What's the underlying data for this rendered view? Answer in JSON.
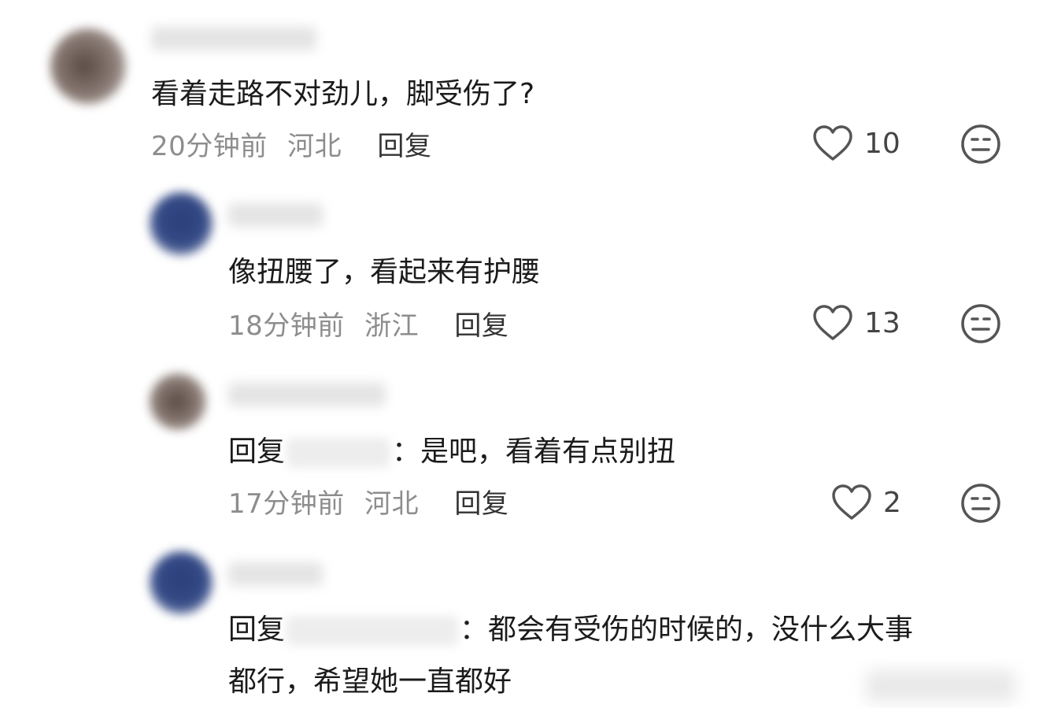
{
  "comments": [
    {
      "text": "看着走路不对劲儿，脚受伤了?",
      "time": "20分钟前",
      "location": "河北",
      "reply_label": "回复",
      "likes": "10"
    },
    {
      "text": "像扭腰了，看起来有护腰",
      "time": "18分钟前",
      "location": "浙江",
      "reply_label": "回复",
      "likes": "13"
    },
    {
      "reply_prefix": "回复",
      "mention_tail": "：",
      "text": "是吧，看着有点别扭",
      "time": "17分钟前",
      "location": "河北",
      "reply_label": "回复",
      "likes": "2"
    },
    {
      "reply_prefix": "回复",
      "mention_tail": "：",
      "text_line1": "都会有受伤的时候的，没什么大事",
      "text_line2": "都行，希望她一直都好"
    }
  ],
  "colors": {
    "text": "#1b1b1b",
    "meta": "#8d8d8d",
    "icon": "#555555"
  },
  "icons": {
    "like": "heart-outline-icon",
    "dislike": "neutral-face-icon"
  }
}
